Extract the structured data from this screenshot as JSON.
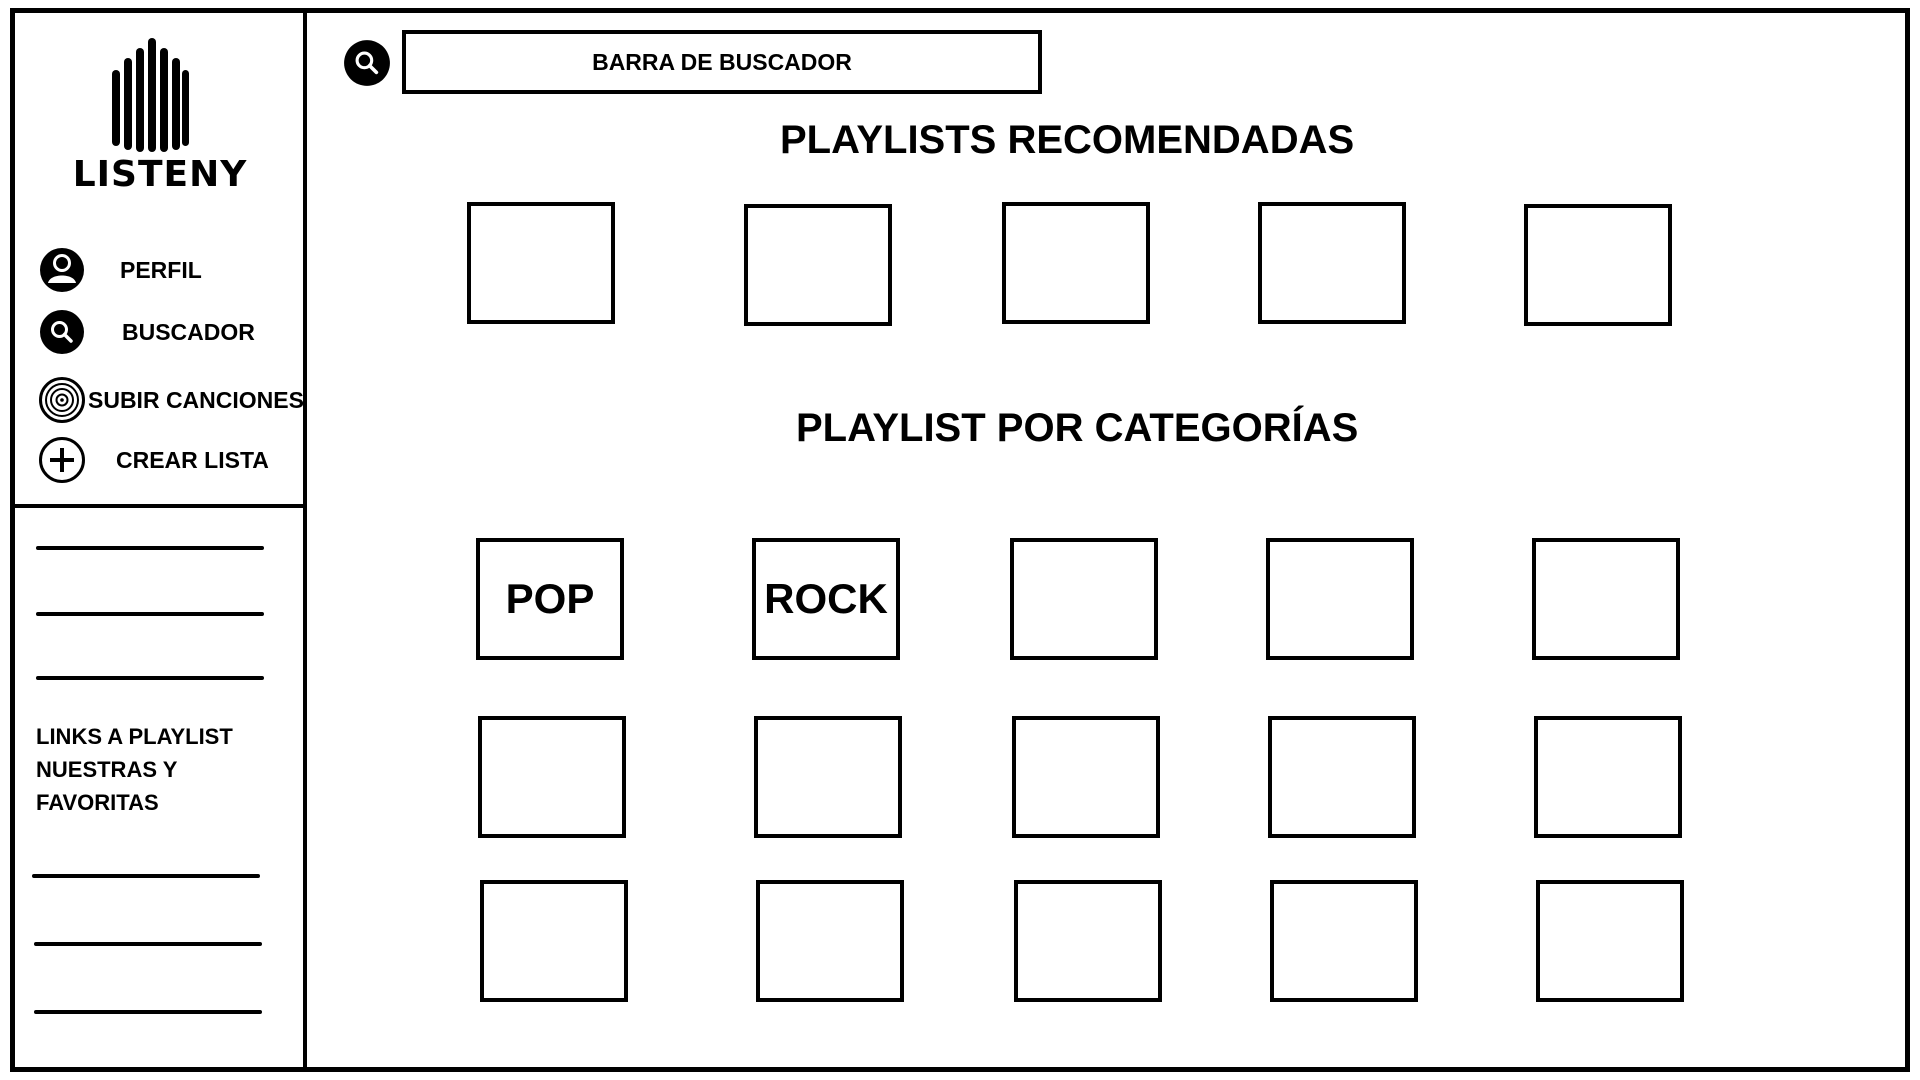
{
  "app": {
    "name": "LISTENY"
  },
  "sidebar": {
    "items": [
      {
        "label": "PERFIL",
        "icon": "user-icon"
      },
      {
        "label": "BUSCADOR",
        "icon": "search-icon"
      },
      {
        "label": "SUBIR CANCIONES",
        "icon": "vinyl-icon"
      },
      {
        "label": "CREAR LISTA",
        "icon": "plus-circle-icon"
      }
    ],
    "links_text": "LINKS A PLAYLIST NUESTRAS Y FAVORITAS"
  },
  "search": {
    "label": "BARRA DE BUSCADOR",
    "icon": "search-icon"
  },
  "recommended": {
    "title": "PLAYLISTS RECOMENDADAS",
    "tiles": [
      "",
      "",
      "",
      "",
      ""
    ]
  },
  "categories": {
    "title": "PLAYLIST POR CATEGORÍAS",
    "tiles": [
      "POP",
      "ROCK",
      "",
      "",
      "",
      "",
      "",
      "",
      "",
      "",
      "",
      "",
      "",
      "",
      ""
    ]
  }
}
